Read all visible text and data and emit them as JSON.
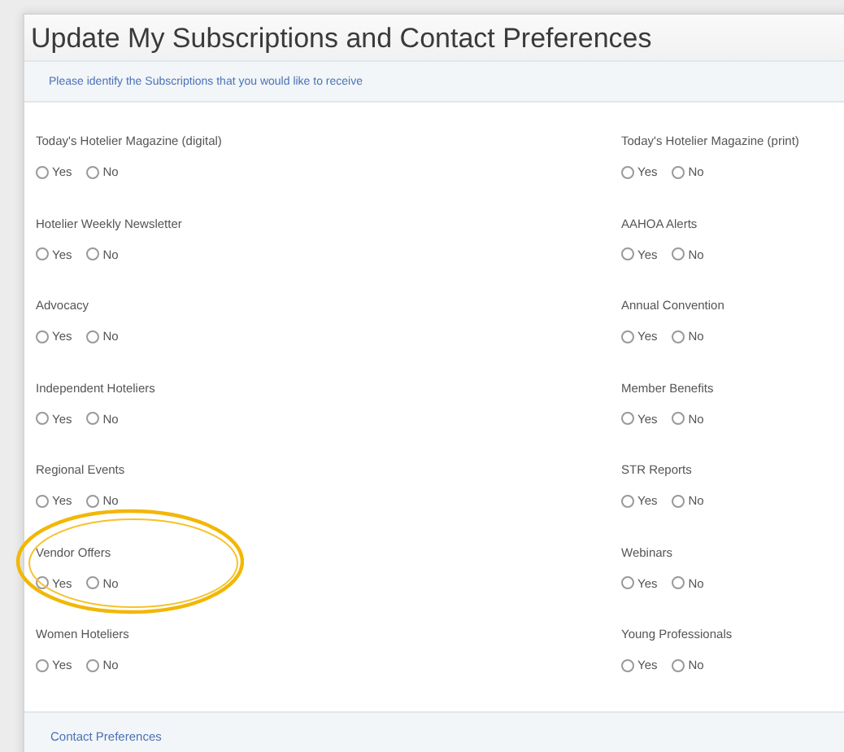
{
  "title": "Update My Subscriptions and Contact Preferences",
  "instruction": "Please identify the Subscriptions that you would like to receive",
  "subscription_rows": [
    {
      "items": [
        {
          "label": "Today's Hotelier Magazine (digital)",
          "circled": false,
          "options": [
            {
              "label": "Yes",
              "selected": false
            },
            {
              "label": "No",
              "selected": false
            }
          ]
        },
        {
          "label": "Today's Hotelier Magazine (print)",
          "circled": false,
          "options": [
            {
              "label": "Yes",
              "selected": false
            },
            {
              "label": "No",
              "selected": false
            }
          ]
        }
      ]
    },
    {
      "items": [
        {
          "label": "Hotelier Weekly Newsletter",
          "circled": false,
          "options": [
            {
              "label": "Yes",
              "selected": false
            },
            {
              "label": "No",
              "selected": false
            }
          ]
        },
        {
          "label": "AAHOA Alerts",
          "circled": false,
          "options": [
            {
              "label": "Yes",
              "selected": false
            },
            {
              "label": "No",
              "selected": false
            }
          ]
        }
      ]
    },
    {
      "items": [
        {
          "label": "Advocacy",
          "circled": false,
          "options": [
            {
              "label": "Yes",
              "selected": false
            },
            {
              "label": "No",
              "selected": false
            }
          ]
        },
        {
          "label": "Annual Convention",
          "circled": false,
          "options": [
            {
              "label": "Yes",
              "selected": false
            },
            {
              "label": "No",
              "selected": false
            }
          ]
        }
      ]
    },
    {
      "items": [
        {
          "label": "Independent Hoteliers",
          "circled": false,
          "options": [
            {
              "label": "Yes",
              "selected": false
            },
            {
              "label": "No",
              "selected": false
            }
          ]
        },
        {
          "label": "Member Benefits",
          "circled": false,
          "options": [
            {
              "label": "Yes",
              "selected": false
            },
            {
              "label": "No",
              "selected": false
            }
          ]
        }
      ]
    },
    {
      "items": [
        {
          "label": "Regional Events",
          "circled": false,
          "options": [
            {
              "label": "Yes",
              "selected": false
            },
            {
              "label": "No",
              "selected": false
            }
          ]
        },
        {
          "label": "STR Reports",
          "circled": false,
          "options": [
            {
              "label": "Yes",
              "selected": false
            },
            {
              "label": "No",
              "selected": false
            }
          ]
        }
      ]
    },
    {
      "items": [
        {
          "label": "Vendor Offers",
          "circled": true,
          "options": [
            {
              "label": "Yes",
              "selected": false
            },
            {
              "label": "No",
              "selected": false
            }
          ]
        },
        {
          "label": "Webinars",
          "circled": false,
          "options": [
            {
              "label": "Yes",
              "selected": false
            },
            {
              "label": "No",
              "selected": false
            }
          ]
        }
      ]
    },
    {
      "items": [
        {
          "label": "Women Hoteliers",
          "circled": false,
          "options": [
            {
              "label": "Yes",
              "selected": false
            },
            {
              "label": "No",
              "selected": false
            }
          ]
        },
        {
          "label": "Young Professionals",
          "circled": false,
          "options": [
            {
              "label": "Yes",
              "selected": false
            },
            {
              "label": "No",
              "selected": false
            }
          ]
        }
      ]
    }
  ],
  "footer_section": "Contact Preferences"
}
